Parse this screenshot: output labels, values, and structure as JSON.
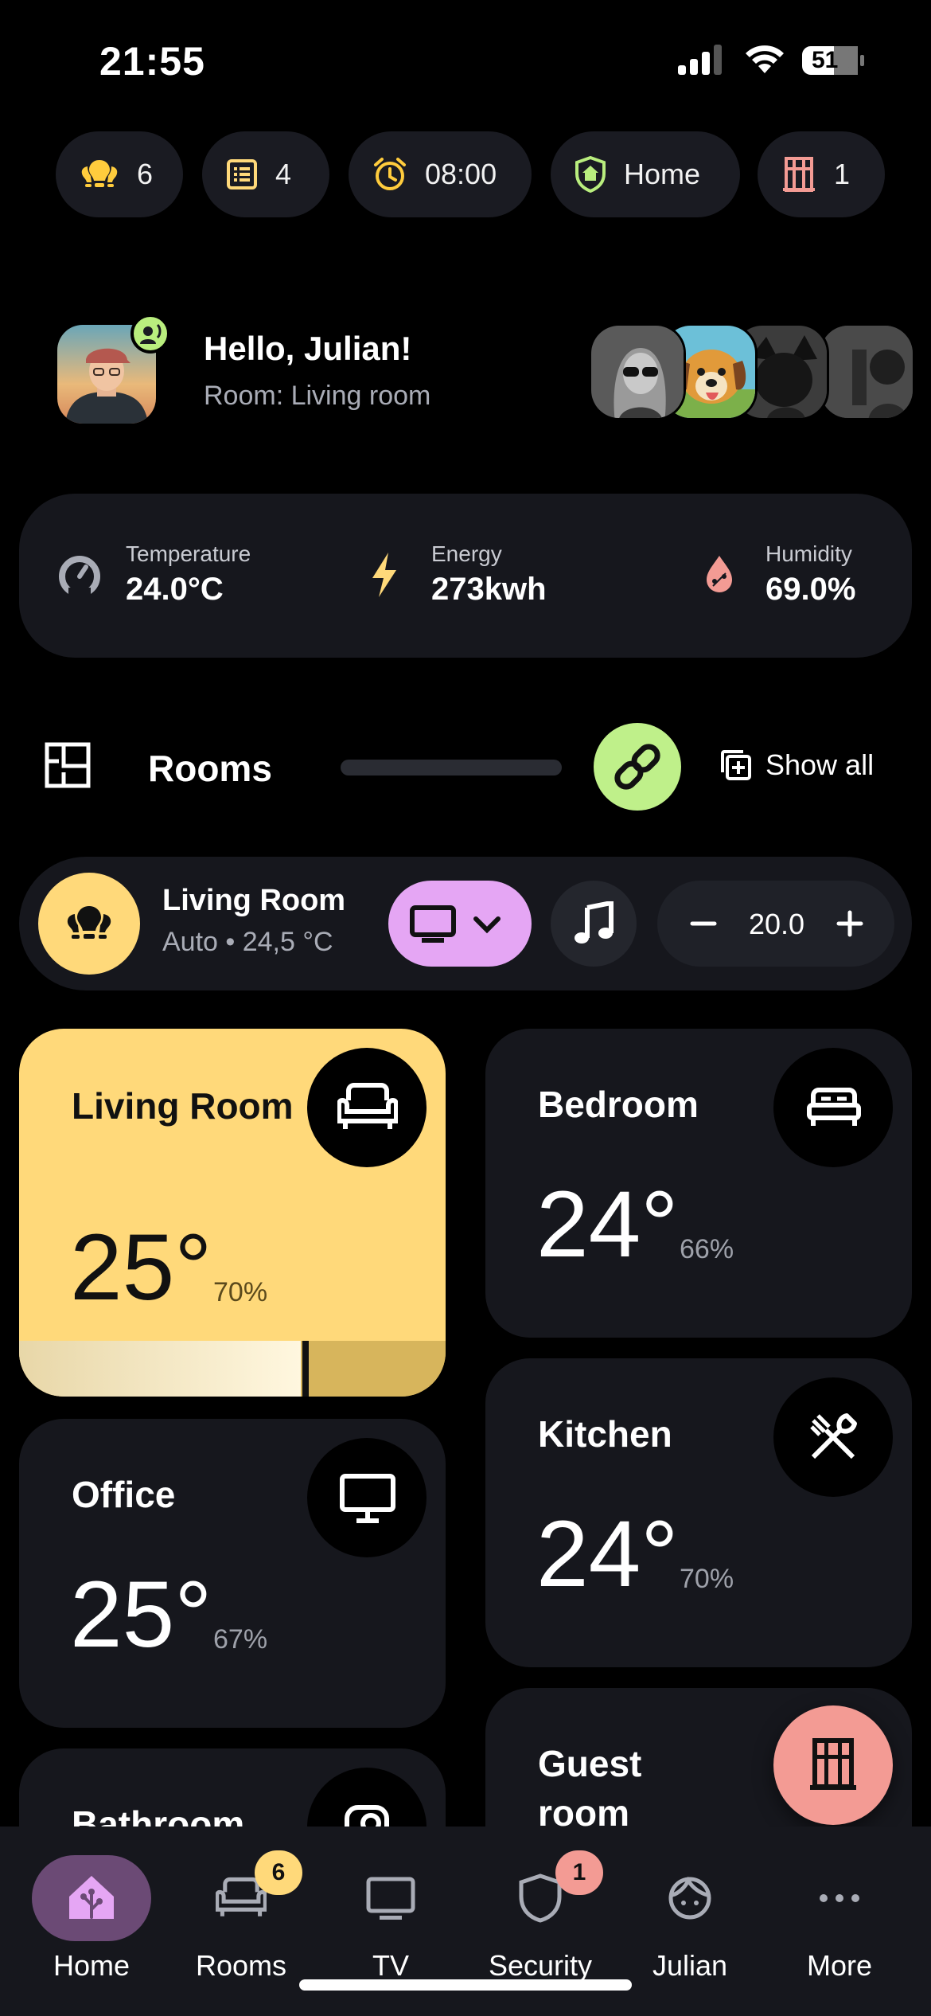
{
  "status_bar": {
    "time": "21:55",
    "battery": "51"
  },
  "chips": [
    {
      "icon": "bulb-group-icon",
      "label": "6",
      "color": "#ffcc3d"
    },
    {
      "icon": "list-icon",
      "label": "4",
      "color": "#ffd97a"
    },
    {
      "icon": "alarm-clock-icon",
      "label": "08:00",
      "color": "#ffcc3d"
    },
    {
      "icon": "shield-home-icon",
      "label": "Home",
      "color": "#b9ee7e"
    },
    {
      "icon": "door-icon",
      "label": "1",
      "color": "#f39b94"
    }
  ],
  "greeting": {
    "hello": "Hello, Julian!",
    "room": "Room: Living room"
  },
  "sensors": [
    {
      "icon": "thermometer-gauge-icon",
      "label": "Temperature",
      "value": "24.0°C"
    },
    {
      "icon": "lightning-icon",
      "label": "Energy",
      "value": "273kwh"
    },
    {
      "icon": "water-drop-icon",
      "label": "Humidity",
      "value": "69.0%"
    }
  ],
  "rooms_header": {
    "title": "Rooms",
    "show_all": "Show all"
  },
  "control_strip": {
    "name": "Living Room",
    "sub": "Auto • 24,5 °C",
    "setpoint": "20.0"
  },
  "cards": [
    {
      "name": "Living Room",
      "temp": "25°",
      "humidity": "70%",
      "icon": "sofa-icon",
      "active": true,
      "level": 0.66
    },
    {
      "name": "Bedroom",
      "temp": "24°",
      "humidity": "66%",
      "icon": "bed-icon",
      "active": false
    },
    {
      "name": "Office",
      "temp": "25°",
      "humidity": "67%",
      "icon": "monitor-icon",
      "active": false
    },
    {
      "name": "Kitchen",
      "temp": "24°",
      "humidity": "70%",
      "icon": "fork-knife-icon",
      "active": false
    },
    {
      "name": "Bathroom",
      "icon": "bath-icon",
      "active": false
    },
    {
      "name": "Guest room",
      "active": false
    }
  ],
  "nav": [
    {
      "label": "Home",
      "icon": "home-assistant-icon",
      "active": true
    },
    {
      "label": "Rooms",
      "icon": "sofa-icon",
      "badge": "6",
      "badge_color": "#ffd97a"
    },
    {
      "label": "TV",
      "icon": "tv-icon"
    },
    {
      "label": "Security",
      "icon": "shield-icon",
      "badge": "1",
      "badge_color": "#f39b94"
    },
    {
      "label": "Julian",
      "icon": "person-face-icon"
    },
    {
      "label": "More",
      "icon": "dots-icon"
    }
  ],
  "colors": {
    "accent_yellow": "#ffd97a",
    "accent_green": "#bff08a",
    "accent_purple": "#e5a6f4",
    "accent_red": "#f39b94",
    "card_bg": "#16171d"
  }
}
